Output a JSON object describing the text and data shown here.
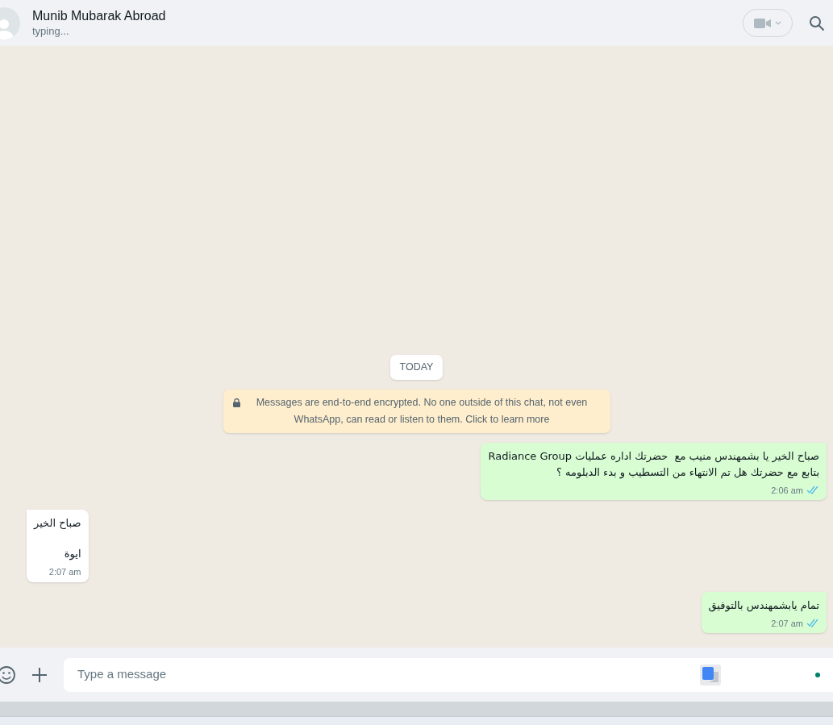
{
  "header": {
    "name": "Munib Mubarak Abroad",
    "status": "typing..."
  },
  "date_divider": "TODAY",
  "encryption_notice": "Messages are end-to-end encrypted. No one outside of this chat, not even WhatsApp, can read or listen to them. Click to learn more",
  "messages": [
    {
      "kind": "outgoing",
      "lines": [
        "صباح الخير يا بشمهندس منيب مع  حضرتك اداره عمليات Radiance Group",
        "بتابع مع حضرتك هل تم الانتهاء من التسطيب و بدء الدبلومه ؟"
      ],
      "time": "2:06 am",
      "read": true
    },
    {
      "kind": "incoming",
      "lines": [
        "صباح الخير",
        "ايوة"
      ],
      "time": "2:07 am"
    },
    {
      "kind": "outgoing",
      "lines": [
        "تمام يابشمهندس بالتوفيق"
      ],
      "time": "2:07 am",
      "read": true
    }
  ],
  "composer": {
    "placeholder": "Type a message"
  }
}
